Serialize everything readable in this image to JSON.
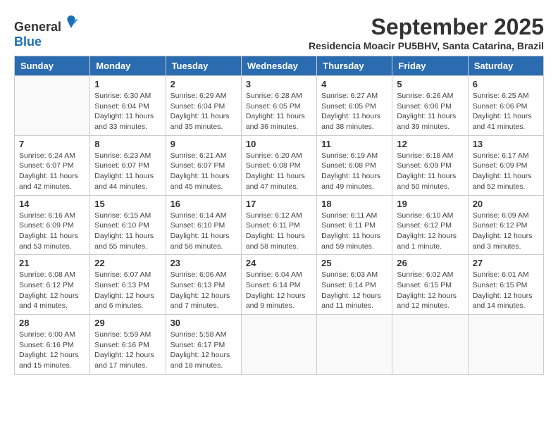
{
  "logo": {
    "general": "General",
    "blue": "Blue"
  },
  "title": "September 2025",
  "subtitle": "Residencia Moacir PU5BHV, Santa Catarina, Brazil",
  "days_of_week": [
    "Sunday",
    "Monday",
    "Tuesday",
    "Wednesday",
    "Thursday",
    "Friday",
    "Saturday"
  ],
  "weeks": [
    [
      {
        "day": "",
        "info": ""
      },
      {
        "day": "1",
        "info": "Sunrise: 6:30 AM\nSunset: 6:04 PM\nDaylight: 11 hours\nand 33 minutes."
      },
      {
        "day": "2",
        "info": "Sunrise: 6:29 AM\nSunset: 6:04 PM\nDaylight: 11 hours\nand 35 minutes."
      },
      {
        "day": "3",
        "info": "Sunrise: 6:28 AM\nSunset: 6:05 PM\nDaylight: 11 hours\nand 36 minutes."
      },
      {
        "day": "4",
        "info": "Sunrise: 6:27 AM\nSunset: 6:05 PM\nDaylight: 11 hours\nand 38 minutes."
      },
      {
        "day": "5",
        "info": "Sunrise: 6:26 AM\nSunset: 6:06 PM\nDaylight: 11 hours\nand 39 minutes."
      },
      {
        "day": "6",
        "info": "Sunrise: 6:25 AM\nSunset: 6:06 PM\nDaylight: 11 hours\nand 41 minutes."
      }
    ],
    [
      {
        "day": "7",
        "info": "Sunrise: 6:24 AM\nSunset: 6:07 PM\nDaylight: 11 hours\nand 42 minutes."
      },
      {
        "day": "8",
        "info": "Sunrise: 6:23 AM\nSunset: 6:07 PM\nDaylight: 11 hours\nand 44 minutes."
      },
      {
        "day": "9",
        "info": "Sunrise: 6:21 AM\nSunset: 6:07 PM\nDaylight: 11 hours\nand 45 minutes."
      },
      {
        "day": "10",
        "info": "Sunrise: 6:20 AM\nSunset: 6:08 PM\nDaylight: 11 hours\nand 47 minutes."
      },
      {
        "day": "11",
        "info": "Sunrise: 6:19 AM\nSunset: 6:08 PM\nDaylight: 11 hours\nand 49 minutes."
      },
      {
        "day": "12",
        "info": "Sunrise: 6:18 AM\nSunset: 6:09 PM\nDaylight: 11 hours\nand 50 minutes."
      },
      {
        "day": "13",
        "info": "Sunrise: 6:17 AM\nSunset: 6:09 PM\nDaylight: 11 hours\nand 52 minutes."
      }
    ],
    [
      {
        "day": "14",
        "info": "Sunrise: 6:16 AM\nSunset: 6:09 PM\nDaylight: 11 hours\nand 53 minutes."
      },
      {
        "day": "15",
        "info": "Sunrise: 6:15 AM\nSunset: 6:10 PM\nDaylight: 11 hours\nand 55 minutes."
      },
      {
        "day": "16",
        "info": "Sunrise: 6:14 AM\nSunset: 6:10 PM\nDaylight: 11 hours\nand 56 minutes."
      },
      {
        "day": "17",
        "info": "Sunrise: 6:12 AM\nSunset: 6:11 PM\nDaylight: 11 hours\nand 58 minutes."
      },
      {
        "day": "18",
        "info": "Sunrise: 6:11 AM\nSunset: 6:11 PM\nDaylight: 11 hours\nand 59 minutes."
      },
      {
        "day": "19",
        "info": "Sunrise: 6:10 AM\nSunset: 6:12 PM\nDaylight: 12 hours\nand 1 minute."
      },
      {
        "day": "20",
        "info": "Sunrise: 6:09 AM\nSunset: 6:12 PM\nDaylight: 12 hours\nand 3 minutes."
      }
    ],
    [
      {
        "day": "21",
        "info": "Sunrise: 6:08 AM\nSunset: 6:12 PM\nDaylight: 12 hours\nand 4 minutes."
      },
      {
        "day": "22",
        "info": "Sunrise: 6:07 AM\nSunset: 6:13 PM\nDaylight: 12 hours\nand 6 minutes."
      },
      {
        "day": "23",
        "info": "Sunrise: 6:06 AM\nSunset: 6:13 PM\nDaylight: 12 hours\nand 7 minutes."
      },
      {
        "day": "24",
        "info": "Sunrise: 6:04 AM\nSunset: 6:14 PM\nDaylight: 12 hours\nand 9 minutes."
      },
      {
        "day": "25",
        "info": "Sunrise: 6:03 AM\nSunset: 6:14 PM\nDaylight: 12 hours\nand 11 minutes."
      },
      {
        "day": "26",
        "info": "Sunrise: 6:02 AM\nSunset: 6:15 PM\nDaylight: 12 hours\nand 12 minutes."
      },
      {
        "day": "27",
        "info": "Sunrise: 6:01 AM\nSunset: 6:15 PM\nDaylight: 12 hours\nand 14 minutes."
      }
    ],
    [
      {
        "day": "28",
        "info": "Sunrise: 6:00 AM\nSunset: 6:16 PM\nDaylight: 12 hours\nand 15 minutes."
      },
      {
        "day": "29",
        "info": "Sunrise: 5:59 AM\nSunset: 6:16 PM\nDaylight: 12 hours\nand 17 minutes."
      },
      {
        "day": "30",
        "info": "Sunrise: 5:58 AM\nSunset: 6:17 PM\nDaylight: 12 hours\nand 18 minutes."
      },
      {
        "day": "",
        "info": ""
      },
      {
        "day": "",
        "info": ""
      },
      {
        "day": "",
        "info": ""
      },
      {
        "day": "",
        "info": ""
      }
    ]
  ]
}
